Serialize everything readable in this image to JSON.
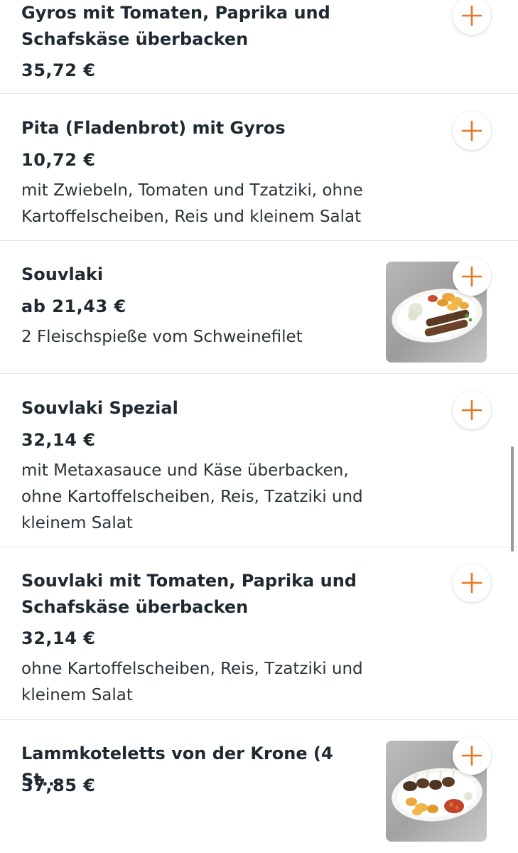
{
  "colors": {
    "accent": "#e87722",
    "text": "#1f2a30",
    "divider": "#e3e3e3"
  },
  "icons": {
    "add": "plus-icon"
  },
  "items": [
    {
      "title": "Gyros mit Tomaten, Paprika und\nSchafskäse überbacken",
      "price": "35,72 €",
      "description": ""
    },
    {
      "title": "Pita (Fladenbrot) mit Gyros",
      "price": "10,72 €",
      "description": "mit Zwiebeln, Tomaten und Tzatziki, ohne\nKartoffelscheiben, Reis und kleinem Salat"
    },
    {
      "title": "Souvlaki",
      "price": "ab 21,43 €",
      "description": "2 Fleischspieße vom Schweinefilet"
    },
    {
      "title": "Souvlaki Spezial",
      "price": "32,14 €",
      "description": "mit Metaxasauce und Käse überbacken,\nohne Kartoffelscheiben, Reis, Tzatziki und\nkleinem Salat"
    },
    {
      "title": "Souvlaki mit Tomaten, Paprika und\nSchafskäse überbacken",
      "price": "32,14 €",
      "description": "ohne Kartoffelscheiben, Reis, Tzatziki und\nkleinem Salat"
    },
    {
      "title": "Lammkoteletts von der Krone (4 St...",
      "price": "37,85 €",
      "description": ""
    }
  ]
}
